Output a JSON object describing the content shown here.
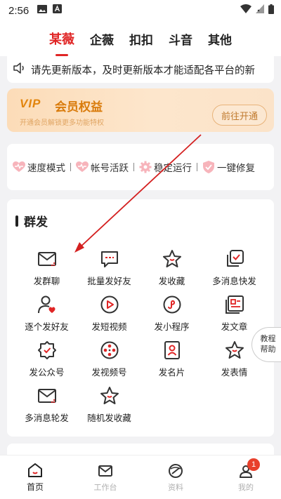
{
  "status_bar": {
    "time": "2:56"
  },
  "top_tabs": [
    {
      "label": "某薇",
      "active": true
    },
    {
      "label": "企薇",
      "active": false
    },
    {
      "label": "扣扣",
      "active": false
    },
    {
      "label": "斗音",
      "active": false
    },
    {
      "label": "其他",
      "active": false
    }
  ],
  "notice": {
    "text": "请先更新版本，及时更新版本才能适配各平台的新"
  },
  "vip": {
    "logo": "VIP",
    "title": "会员权益",
    "desc": "开通会员解锁更多功能特权",
    "button": "前往开通"
  },
  "features": [
    "速度模式",
    "帐号活跃",
    "稳定运行",
    "一键修复"
  ],
  "group_send": {
    "title": "群发",
    "items": [
      {
        "label": "发群聊",
        "icon": "chat-group-icon"
      },
      {
        "label": "批量发好友",
        "icon": "message-bubble-icon"
      },
      {
        "label": "发收藏",
        "icon": "star-icon"
      },
      {
        "label": "多消息快发",
        "icon": "multi-check-icon"
      },
      {
        "label": "逐个发好友",
        "icon": "user-heart-icon"
      },
      {
        "label": "发短视频",
        "icon": "play-icon"
      },
      {
        "label": "发小程序",
        "icon": "mini-program-icon"
      },
      {
        "label": "发文章",
        "icon": "article-icon"
      },
      {
        "label": "发公众号",
        "icon": "official-account-icon"
      },
      {
        "label": "发视频号",
        "icon": "video-channel-icon"
      },
      {
        "label": "发名片",
        "icon": "card-icon"
      },
      {
        "label": "发表情",
        "icon": "sticker-star-icon"
      },
      {
        "label": "多消息轮发",
        "icon": "chat-rotate-icon"
      },
      {
        "label": "随机发收藏",
        "icon": "random-star-icon"
      }
    ]
  },
  "help": {
    "line1": "教程",
    "line2": "帮助"
  },
  "bottom_nav": [
    {
      "label": "首页",
      "icon": "home-icon",
      "active": true
    },
    {
      "label": "工作台",
      "icon": "workbench-icon",
      "active": false
    },
    {
      "label": "资料",
      "icon": "materials-icon",
      "active": false
    },
    {
      "label": "我的",
      "icon": "profile-icon",
      "active": false,
      "badge": "1"
    }
  ],
  "colors": {
    "accent": "#e02525",
    "vip_gold": "#d97b0b",
    "badge": "#e8402c"
  }
}
